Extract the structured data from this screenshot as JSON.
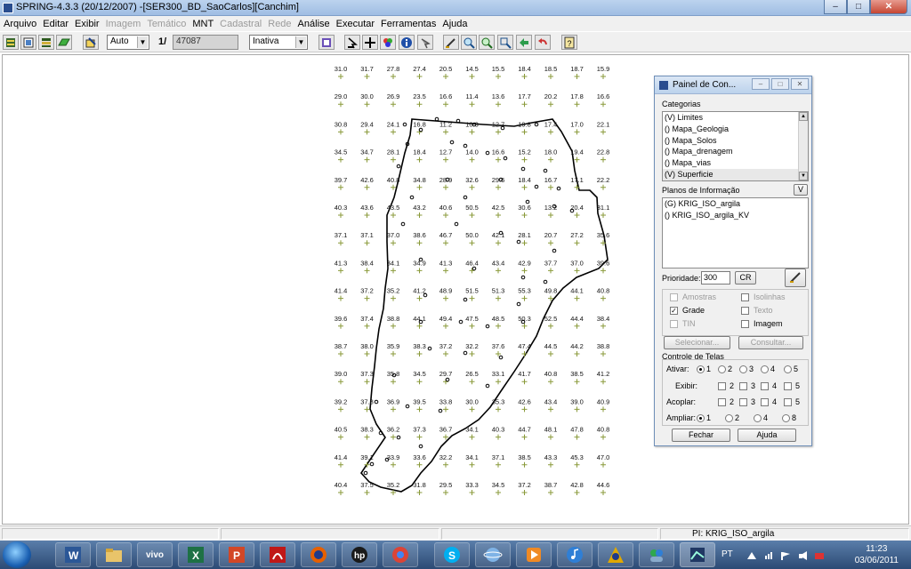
{
  "window": {
    "title": "SPRING-4.3.3 (20/12/2007) -[SER300_BD_SaoCarlos][Canchim]",
    "controls": [
      "–",
      "□",
      "✕"
    ]
  },
  "menu": [
    {
      "label": "Arquivo",
      "enabled": true
    },
    {
      "label": "Editar",
      "enabled": true
    },
    {
      "label": "Exibir",
      "enabled": true
    },
    {
      "label": "Imagem",
      "enabled": false
    },
    {
      "label": "Temático",
      "enabled": false
    },
    {
      "label": "MNT",
      "enabled": true
    },
    {
      "label": "Cadastral",
      "enabled": false
    },
    {
      "label": "Rede",
      "enabled": false
    },
    {
      "label": "Análise",
      "enabled": true
    },
    {
      "label": "Executar",
      "enabled": true
    },
    {
      "label": "Ferramentas",
      "enabled": true
    },
    {
      "label": "Ajuda",
      "enabled": true
    }
  ],
  "toolbar": {
    "zoom_mode": "Auto",
    "scale_prefix": "1/",
    "scale_value": "47087",
    "active_mode": "Inativa"
  },
  "grid": {
    "rows": [
      [
        "31.0",
        "31.7",
        "27.8",
        "27.4",
        "20.5",
        "14.5",
        "15.5",
        "18.4",
        "18.5",
        "18.7",
        "15.9"
      ],
      [
        "29.0",
        "30.0",
        "26.9",
        "23.5",
        "16.6",
        "11.4",
        "13.6",
        "17.7",
        "20.2",
        "17.8",
        "16.6"
      ],
      [
        "30.8",
        "29.4",
        "24.1",
        "16.8",
        "11.2",
        "10.3",
        "12.7",
        "19.8",
        "17.4",
        "17.0",
        "22.1"
      ],
      [
        "34.5",
        "34.7",
        "28.1",
        "18.4",
        "12.7",
        "14.0",
        "16.6",
        "15.2",
        "18.0",
        "19.4",
        "22.8"
      ],
      [
        "39.7",
        "42.6",
        "40.8",
        "34.8",
        "28.9",
        "32.6",
        "29.6",
        "18.4",
        "16.7",
        "17.1",
        "22.2"
      ],
      [
        "40.3",
        "43.6",
        "43.5",
        "43.2",
        "40.6",
        "50.5",
        "42.5",
        "30.6",
        "13.2",
        "20.4",
        "31.1"
      ],
      [
        "37.1",
        "37.1",
        "37.0",
        "38.6",
        "46.7",
        "50.0",
        "42.1",
        "28.1",
        "20.7",
        "27.2",
        "35.6"
      ],
      [
        "41.3",
        "38.4",
        "34.1",
        "34.9",
        "41.3",
        "46.4",
        "43.4",
        "42.9",
        "37.7",
        "37.0",
        "39.6"
      ],
      [
        "41.4",
        "37.2",
        "35.2",
        "41.2",
        "48.9",
        "51.5",
        "51.3",
        "55.3",
        "49.8",
        "44.1",
        "40.8"
      ],
      [
        "39.6",
        "37.4",
        "38.8",
        "44.1",
        "49.4",
        "47.5",
        "48.5",
        "50.3",
        "52.5",
        "44.4",
        "38.4"
      ],
      [
        "38.7",
        "38.0",
        "35.9",
        "38.3",
        "37.2",
        "32.2",
        "37.6",
        "47.4",
        "44.5",
        "44.2",
        "38.8"
      ],
      [
        "39.0",
        "37.3",
        "35.8",
        "34.5",
        "29.7",
        "26.5",
        "33.1",
        "41.7",
        "40.8",
        "38.5",
        "41.2"
      ],
      [
        "39.2",
        "37.8",
        "36.9",
        "39.5",
        "33.8",
        "30.0",
        "35.3",
        "42.6",
        "43.4",
        "39.0",
        "40.9"
      ],
      [
        "40.5",
        "38.3",
        "36.2",
        "37.3",
        "36.7",
        "34.1",
        "40.3",
        "44.7",
        "48.1",
        "47.8",
        "40.8"
      ],
      [
        "41.4",
        "39.1",
        "33.9",
        "33.6",
        "32.2",
        "34.1",
        "37.1",
        "38.5",
        "43.3",
        "45.3",
        "47.0"
      ],
      [
        "40.4",
        "37.5",
        "35.2",
        "31.8",
        "29.5",
        "33.3",
        "34.5",
        "37.2",
        "38.7",
        "42.8",
        "44.6"
      ]
    ]
  },
  "panel": {
    "title": "Painel de Con...",
    "categories_label": "Categorias",
    "categories": [
      "(V) Limites",
      "() Mapa_Geologia",
      "() Mapa_Solos",
      "() Mapa_drenagem",
      "() Mapa_vias",
      "(V) Superficie"
    ],
    "planes_label": "Planos de Informação",
    "planes_filter": "V",
    "planes": [
      "(G) KRIG_ISO_argila",
      "() KRIG_ISO_argila_KV"
    ],
    "priority_label": "Prioridade:",
    "priority_value": "300",
    "cr_label": "CR",
    "checks": {
      "amostras": "Amostras",
      "isolinhas": "Isolinhas",
      "grade": "Grade",
      "texto": "Texto",
      "tin": "TIN",
      "imagem": "Imagem"
    },
    "select_button": "Selecionar...",
    "consult_button": "Consultar...",
    "screens_label": "Controle de Telas",
    "ativar_label": "Ativar:",
    "exibir_label": "Exibir:",
    "acoplar_label": "Acoplar:",
    "ampliar_label": "Ampliar:",
    "screen_numbers": [
      "1",
      "2",
      "3",
      "4",
      "5"
    ],
    "ampliar_values": [
      "1",
      "2",
      "4",
      "8"
    ],
    "close_button": "Fechar",
    "help_button": "Ajuda"
  },
  "status": {
    "pi": "PI: KRIG_ISO_argila"
  },
  "taskbar": {
    "apps": [
      "start-orb",
      "word-icon",
      "explorer-icon",
      "vivo",
      "excel-icon",
      "powerpoint-icon",
      "acrobat-icon",
      "firefox-icon",
      "hp-icon",
      "chrome-icon",
      "skype-icon",
      "network-icon",
      "media-icon",
      "itunes-icon",
      "hyperterminal-icon",
      "messenger-icon",
      "spring-icon"
    ],
    "vivo_label": "vivo",
    "language": "PT",
    "time": "11:23",
    "date": "03/06/2011"
  }
}
